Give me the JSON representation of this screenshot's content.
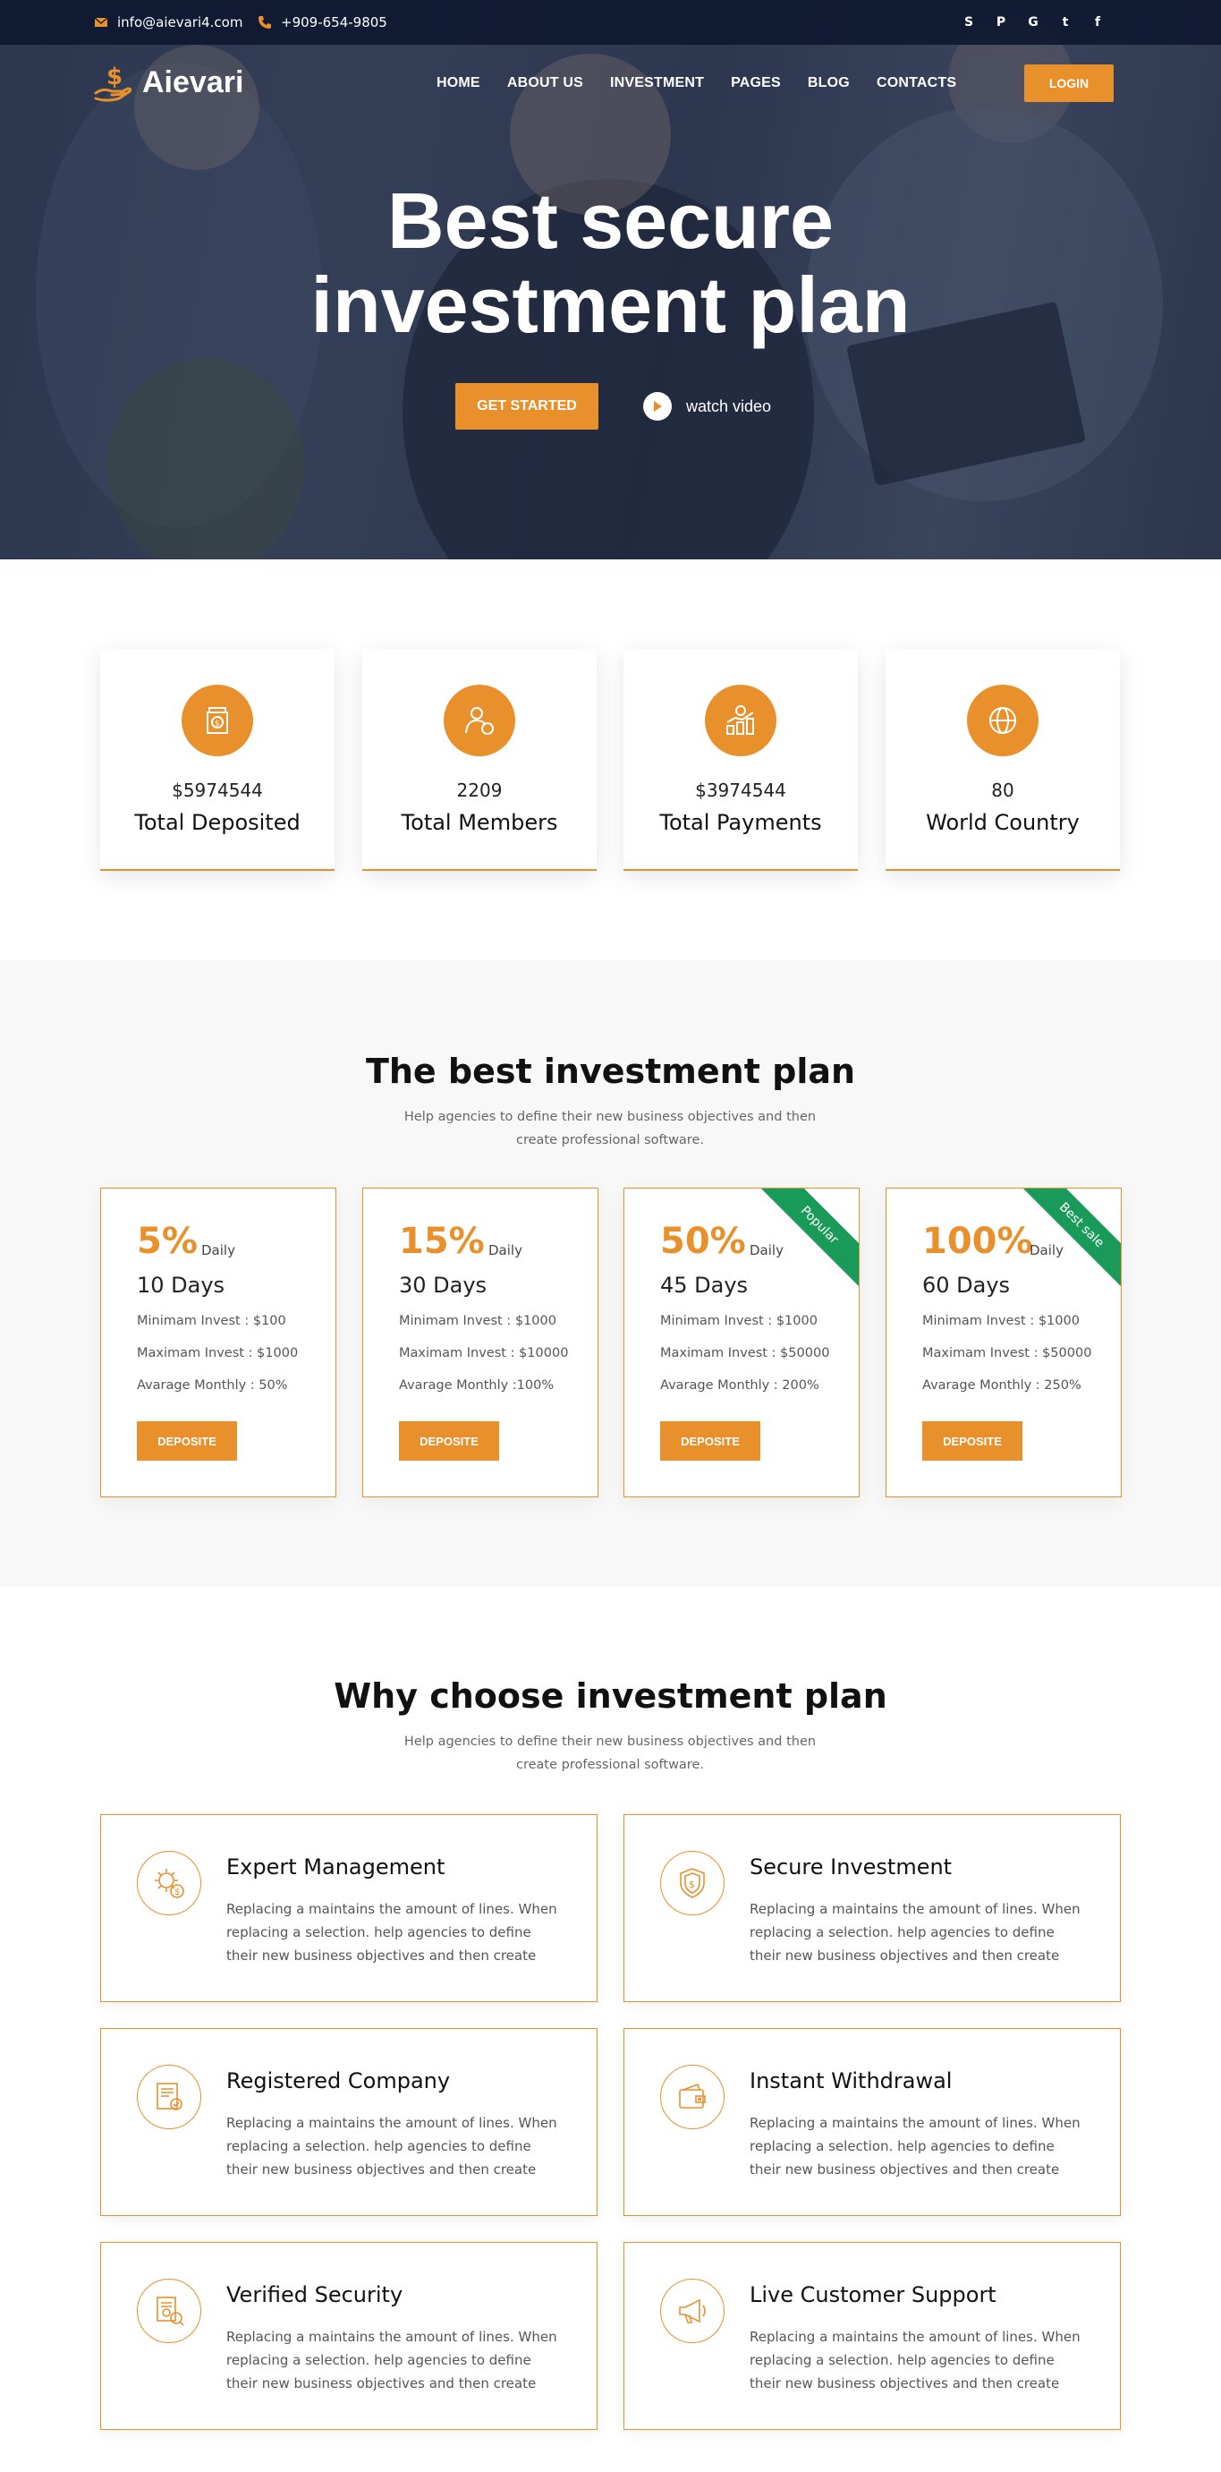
{
  "topbar": {
    "email": "info@aievari4.com",
    "phone": "+909-654-9805",
    "socials": [
      {
        "icon": "skype-icon",
        "glyph": "S"
      },
      {
        "icon": "pinterest-icon",
        "glyph": "P"
      },
      {
        "icon": "google-icon",
        "glyph": "G"
      },
      {
        "icon": "twitter-icon",
        "glyph": "t"
      },
      {
        "icon": "facebook-icon",
        "glyph": "f"
      }
    ]
  },
  "brand": {
    "name": "Aievari",
    "accent": "#e8902c",
    "badge_green": "#1a9a58"
  },
  "nav": {
    "items": [
      "HOME",
      "ABOUT US",
      "INVESTMENT",
      "PAGES",
      "BLOG",
      "CONTACTS"
    ],
    "login": "LOGIN"
  },
  "hero": {
    "title_line1": "Best secure",
    "title_line2": "investment plan",
    "cta": "GET STARTED",
    "watch": "watch video"
  },
  "stats": [
    {
      "value": "$5974544",
      "label": "Total Deposited",
      "icon": "money-jar-icon"
    },
    {
      "value": "2209",
      "label": "Total Members",
      "icon": "member-badge-icon"
    },
    {
      "value": "$3974544",
      "label": "Total Payments",
      "icon": "payment-growth-icon"
    },
    {
      "value": "80",
      "label": "World Country",
      "icon": "globe-dollar-icon"
    }
  ],
  "plans_section": {
    "title": "The best investment plan",
    "subtitle": "Help agencies to define their new business objectives and then create professional software.",
    "plans": [
      {
        "rate": "5%",
        "period": "Daily",
        "days": "10 Days",
        "min": "Minimam Invest : $100",
        "max": "Maximam Invest : $1000",
        "monthly": "Avarage Monthly : 50%",
        "button": "DEPOSITE",
        "ribbon": ""
      },
      {
        "rate": "15%",
        "period": "Daily",
        "days": "30 Days",
        "min": "Minimam Invest : $1000",
        "max": "Maximam Invest : $10000",
        "monthly": "Avarage Monthly :100%",
        "button": "DEPOSITE",
        "ribbon": ""
      },
      {
        "rate": "50%",
        "period": "Daily",
        "days": "45 Days",
        "min": "Minimam Invest : $1000",
        "max": "Maximam Invest : $50000",
        "monthly": "Avarage Monthly : 200%",
        "button": "DEPOSITE",
        "ribbon": "Popular"
      },
      {
        "rate": "100%",
        "period": "Daily",
        "days": "60 Days",
        "min": "Minimam Invest : $1000",
        "max": "Maximam Invest : $50000",
        "monthly": "Avarage Monthly : 250%",
        "button": "DEPOSITE",
        "ribbon": "Best sale"
      }
    ]
  },
  "why_section": {
    "title": "Why choose investment plan",
    "subtitle": "Help agencies to define their new business objectives and then create professional software.",
    "features": [
      {
        "title": "Expert Management",
        "desc": "Replacing a maintains the amount of lines. When replacing a selection. help agencies to define their new business objectives and then create",
        "icon": "gear-dollar-icon"
      },
      {
        "title": "Secure Investment",
        "desc": "Replacing a maintains the amount of lines. When replacing a selection. help agencies to define their new business objectives and then create",
        "icon": "shield-dollar-icon"
      },
      {
        "title": "Registered Company",
        "desc": "Replacing a maintains the amount of lines. When replacing a selection. help agencies to define their new business objectives and then create",
        "icon": "certificate-icon"
      },
      {
        "title": "Instant Withdrawal",
        "desc": "Replacing a maintains the amount of lines. When replacing a selection. help agencies to define their new business objectives and then create",
        "icon": "wallet-icon"
      },
      {
        "title": "Verified Security",
        "desc": "Replacing a maintains the amount of lines. When replacing a selection. help agencies to define their new business objectives and then create",
        "icon": "verified-document-icon"
      },
      {
        "title": "Live Customer Support",
        "desc": "Replacing a maintains the amount of lines. When replacing a selection. help agencies to define their new business objectives and then create",
        "icon": "megaphone-icon"
      }
    ]
  }
}
